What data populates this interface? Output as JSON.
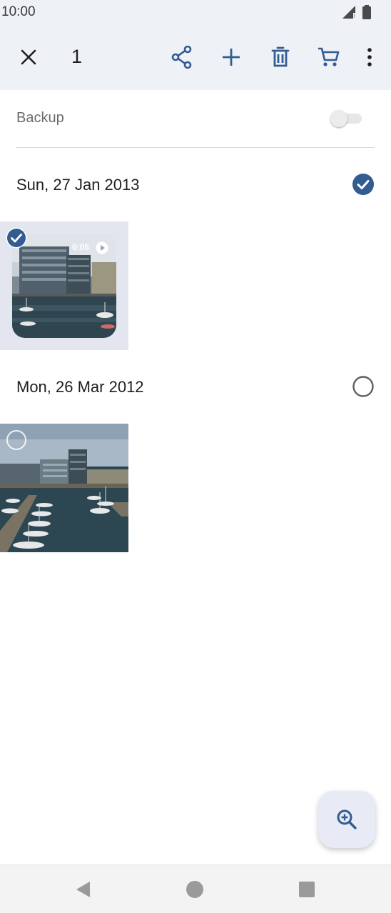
{
  "status_bar": {
    "time": "10:00"
  },
  "action_bar": {
    "selected_count": "1",
    "icons": [
      "close-icon",
      "share-icon",
      "add-icon",
      "delete-icon",
      "cart-icon",
      "more-vert-icon"
    ]
  },
  "backup": {
    "label": "Backup",
    "enabled": false
  },
  "sections": [
    {
      "date": "Sun, 27 Jan 2013",
      "selected": true,
      "video_duration": "0:05"
    },
    {
      "date": "Mon, 26 Mar 2012",
      "selected": false
    }
  ],
  "colors": {
    "accent": "#335c91",
    "topbar_bg": "#eef1f6",
    "selected_bg": "#e3e6ef"
  }
}
